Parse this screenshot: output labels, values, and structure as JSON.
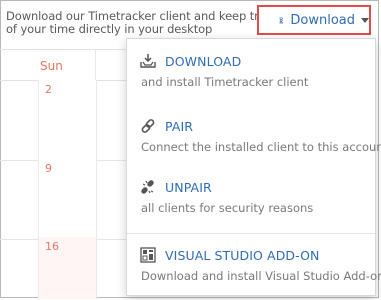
{
  "info": {
    "line1": "Download our Timetracker client and keep track",
    "line2": "of your time directly in your desktop"
  },
  "download_button": {
    "label": "Download",
    "icon": "hourglass-icon"
  },
  "calendar": {
    "day_header": "Sun",
    "days": [
      "2",
      "9",
      "16"
    ]
  },
  "menu": {
    "items": [
      {
        "title": "DOWNLOAD",
        "description": "and install Timetracker client",
        "icon": "download-tray-icon"
      },
      {
        "title": "PAIR",
        "description": "Connect the installed client to this account",
        "icon": "link-icon"
      },
      {
        "title": "UNPAIR",
        "description": "all clients for security reasons",
        "icon": "broken-link-icon"
      },
      {
        "title": "VISUAL STUDIO ADD-ON",
        "description": "Download and install Visual Studio Add-on",
        "icon": "visual-studio-icon"
      }
    ]
  },
  "colors": {
    "accent": "#2f6db5",
    "highlight_border": "#e04b4b",
    "weekend_red": "#e0735f"
  }
}
